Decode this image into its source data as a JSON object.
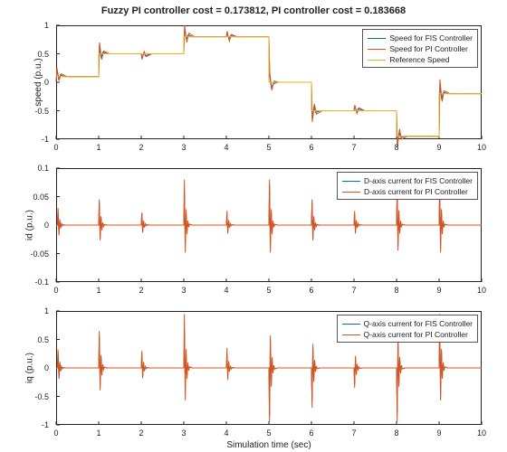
{
  "title": "Fuzzy PI controller cost = 0.173812, PI controller cost = 0.183668",
  "xlabel": "Simulation time (sec)",
  "chart_data": [
    {
      "type": "line",
      "ylabel": "speed (p.u.)",
      "xlim": [
        0,
        10
      ],
      "ylim": [
        -1,
        1
      ],
      "xticks": [
        0,
        1,
        2,
        3,
        4,
        5,
        6,
        7,
        8,
        9,
        10
      ],
      "yticks": [
        -1,
        -0.5,
        0,
        0.5,
        1
      ],
      "legend": {
        "pos": "top-right",
        "entries": [
          "Speed for FIS Controller",
          "Speed for PI Controller",
          "Reference Speed"
        ]
      },
      "series": [
        {
          "name": "Speed for FIS Controller",
          "color": "blue",
          "x": [
            0,
            0.02,
            0.06,
            0.1,
            0.2,
            1,
            1.02,
            1.06,
            1.1,
            1.2,
            2,
            2.02,
            2.06,
            2.1,
            2.2,
            3,
            3.02,
            3.06,
            3.1,
            3.2,
            4,
            4.02,
            4.06,
            4.1,
            4.2,
            5,
            5.02,
            5.06,
            5.1,
            5.2,
            6,
            6.02,
            6.06,
            6.1,
            6.2,
            7,
            7.02,
            7.06,
            7.1,
            7.2,
            8,
            8.02,
            8.06,
            8.1,
            8.2,
            9,
            9.02,
            9.06,
            9.1,
            9.2,
            10
          ],
          "y": [
            0,
            0.22,
            0.05,
            0.13,
            0.1,
            0.1,
            0.65,
            0.42,
            0.53,
            0.5,
            0.5,
            0.42,
            0.52,
            0.46,
            0.5,
            0.5,
            0.95,
            0.76,
            0.83,
            0.8,
            0.8,
            0.87,
            0.76,
            0.82,
            0.8,
            0.8,
            0.12,
            -0.1,
            -0.03,
            0,
            0,
            -0.65,
            -0.42,
            -0.53,
            -0.5,
            -0.5,
            -0.42,
            -0.52,
            -0.46,
            -0.5,
            -0.5,
            -1.1,
            -0.88,
            -0.97,
            -0.95,
            -0.95,
            -0.02,
            -0.3,
            -0.18,
            -0.2,
            -0.2
          ]
        },
        {
          "name": "Speed for PI Controller",
          "color": "red",
          "x": [
            0,
            0.02,
            0.07,
            0.12,
            0.25,
            1,
            1.02,
            1.07,
            1.12,
            1.25,
            2,
            2.02,
            2.07,
            2.12,
            2.25,
            3,
            3.02,
            3.07,
            3.12,
            3.25,
            4,
            4.02,
            4.07,
            4.12,
            4.25,
            5,
            5.02,
            5.07,
            5.12,
            5.25,
            6,
            6.02,
            6.07,
            6.12,
            6.25,
            7,
            7.02,
            7.07,
            7.12,
            7.25,
            8,
            8.02,
            8.07,
            8.12,
            8.25,
            9,
            9.02,
            9.07,
            9.12,
            9.25,
            10
          ],
          "y": [
            0,
            0.25,
            0.03,
            0.15,
            0.1,
            0.1,
            0.7,
            0.4,
            0.55,
            0.5,
            0.5,
            0.4,
            0.54,
            0.45,
            0.5,
            0.5,
            1.0,
            0.7,
            0.86,
            0.8,
            0.8,
            0.9,
            0.72,
            0.84,
            0.8,
            0.8,
            0.18,
            -0.14,
            0.02,
            0,
            0,
            -0.7,
            -0.38,
            -0.56,
            -0.5,
            -0.5,
            -0.4,
            -0.55,
            -0.45,
            -0.5,
            -0.5,
            -1.15,
            -0.82,
            -1.0,
            -0.95,
            -0.95,
            0.05,
            -0.34,
            -0.15,
            -0.2,
            -0.2
          ]
        },
        {
          "name": "Reference Speed",
          "color": "yel",
          "x": [
            0,
            1,
            1,
            2,
            2,
            3,
            3,
            4,
            4,
            5,
            5,
            6,
            6,
            7,
            7,
            8,
            8,
            9,
            9,
            10
          ],
          "y": [
            0.1,
            0.1,
            0.5,
            0.5,
            0.5,
            0.5,
            0.8,
            0.8,
            0.8,
            0.8,
            0,
            0,
            -0.5,
            -0.5,
            -0.5,
            -0.5,
            -0.95,
            -0.95,
            -0.2,
            -0.2
          ]
        }
      ]
    },
    {
      "type": "line",
      "ylabel": "id (p.u.)",
      "xlim": [
        0,
        10
      ],
      "ylim": [
        -0.1,
        0.1
      ],
      "xticks": [
        0,
        1,
        2,
        3,
        4,
        5,
        6,
        7,
        8,
        9,
        10
      ],
      "yticks": [
        -0.1,
        -0.05,
        0,
        0.05,
        0.1
      ],
      "legend": {
        "pos": "top-right",
        "entries": [
          "D-axis current for FIS Controller",
          "D-axis current for PI Controller"
        ]
      },
      "series": [
        {
          "name": "D-axis current for FIS Controller",
          "color": "blue",
          "burst_x": [
            0.03,
            1,
            2,
            3,
            4,
            5,
            6,
            7,
            8,
            9
          ],
          "burst_a": [
            0.025,
            0.04,
            0.02,
            0.06,
            0.02,
            0.07,
            0.04,
            0.02,
            0.06,
            0.07
          ]
        },
        {
          "name": "D-axis current for PI Controller",
          "color": "red",
          "burst_x": [
            0.03,
            1,
            2,
            3,
            4,
            5,
            6,
            7,
            8,
            9
          ],
          "burst_a": [
            0.03,
            0.045,
            0.022,
            0.08,
            0.025,
            0.08,
            0.045,
            0.025,
            0.075,
            0.08
          ]
        }
      ]
    },
    {
      "type": "line",
      "ylabel": "iq (p.u.)",
      "xlim": [
        0,
        10
      ],
      "ylim": [
        -1,
        1
      ],
      "xticks": [
        0,
        1,
        2,
        3,
        4,
        5,
        6,
        7,
        8,
        9,
        10
      ],
      "yticks": [
        -1,
        -0.5,
        0,
        0.5,
        1
      ],
      "legend": {
        "pos": "top-right",
        "entries": [
          "Q-axis current for FIS Controller",
          "Q-axis current for PI Controller"
        ]
      },
      "series": [
        {
          "name": "Q-axis current for FIS Controller",
          "color": "blue",
          "burst_x": [
            0.03,
            1,
            2,
            3,
            4,
            5,
            6,
            7,
            8,
            9
          ],
          "burst_a": [
            0.28,
            0.55,
            0.25,
            0.65,
            0.25,
            0.85,
            0.6,
            0.28,
            0.8,
            0.9
          ],
          "sign": [
            1,
            1,
            1,
            1,
            1,
            -1,
            -1,
            -1,
            -1,
            1
          ]
        },
        {
          "name": "Q-axis current for PI Controller",
          "color": "red",
          "burst_x": [
            0.03,
            1,
            2,
            3,
            4,
            5,
            6,
            7,
            8,
            9
          ],
          "burst_a": [
            0.32,
            0.65,
            0.3,
            0.95,
            0.35,
            0.95,
            0.7,
            0.35,
            0.95,
            0.95
          ],
          "sign": [
            1,
            1,
            1,
            1,
            1,
            -1,
            -1,
            -1,
            -1,
            1
          ]
        }
      ]
    }
  ]
}
